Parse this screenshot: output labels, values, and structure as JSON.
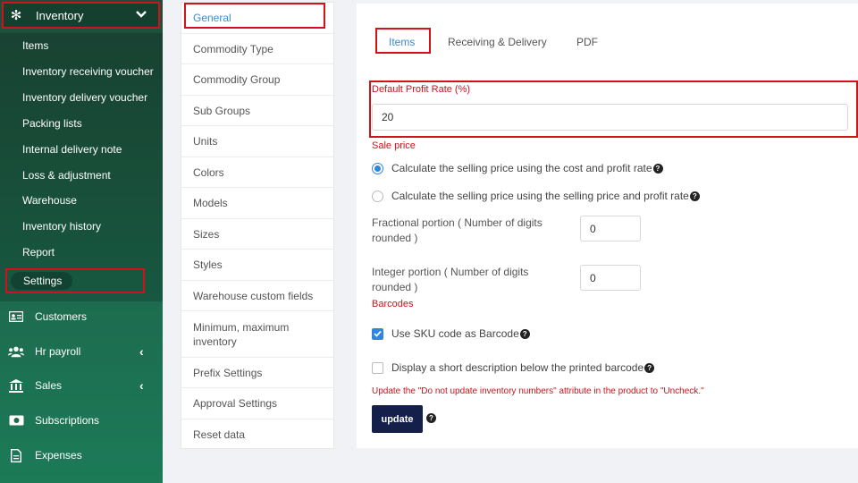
{
  "sidebar": {
    "header": {
      "label": "Inventory",
      "icon": "snowflake-icon"
    },
    "sub_items": [
      {
        "label": "Items"
      },
      {
        "label": "Inventory receiving voucher"
      },
      {
        "label": "Inventory delivery voucher"
      },
      {
        "label": "Packing lists"
      },
      {
        "label": "Internal delivery note"
      },
      {
        "label": "Loss & adjustment"
      },
      {
        "label": "Warehouse"
      },
      {
        "label": "Inventory history"
      },
      {
        "label": "Report"
      }
    ],
    "settings_label": "Settings",
    "main_items": [
      {
        "label": "Customers",
        "icon": "id-card-icon"
      },
      {
        "label": "Hr payroll",
        "icon": "users-icon"
      },
      {
        "label": "Sales",
        "icon": "bank-icon"
      },
      {
        "label": "Subscriptions",
        "icon": "money-icon"
      },
      {
        "label": "Expenses",
        "icon": "file-icon"
      }
    ]
  },
  "submenu": {
    "items": [
      {
        "label": "General"
      },
      {
        "label": "Commodity Type"
      },
      {
        "label": "Commodity Group"
      },
      {
        "label": "Sub Groups"
      },
      {
        "label": "Units"
      },
      {
        "label": "Colors"
      },
      {
        "label": "Models"
      },
      {
        "label": "Sizes"
      },
      {
        "label": "Styles"
      },
      {
        "label": "Warehouse custom fields"
      },
      {
        "label": "Minimum, maximum inventory"
      },
      {
        "label": "Prefix Settings"
      },
      {
        "label": "Approval Settings"
      },
      {
        "label": "Reset data"
      }
    ]
  },
  "main": {
    "tabs": [
      {
        "label": "Items"
      },
      {
        "label": "Receiving & Delivery"
      },
      {
        "label": "PDF"
      }
    ],
    "profit_rate": {
      "label": "Default Profit Rate (%)",
      "value": "20"
    },
    "sale_price_label": "Sale price",
    "radio_cost": "Calculate the selling price using the cost and profit rate",
    "radio_selling": "Calculate the selling price using the selling price and profit rate",
    "fractional": {
      "label": "Fractional portion ( Number of digits rounded )",
      "value": "0"
    },
    "integer": {
      "label": "Integer portion ( Number of digits rounded )",
      "value": "0"
    },
    "barcodes_label": "Barcodes",
    "use_sku": "Use SKU code as Barcode",
    "short_desc": "Display a short description below the printed barcode",
    "warning": "Update the \"Do not update inventory numbers\" attribute in the product to \"Uncheck.\"",
    "update_label": "update"
  },
  "colors": {
    "accent_red": "#d0121b",
    "link_blue": "#3a8bd1",
    "sidebar_green": "#1d6b4e",
    "button_navy": "#15204a"
  }
}
